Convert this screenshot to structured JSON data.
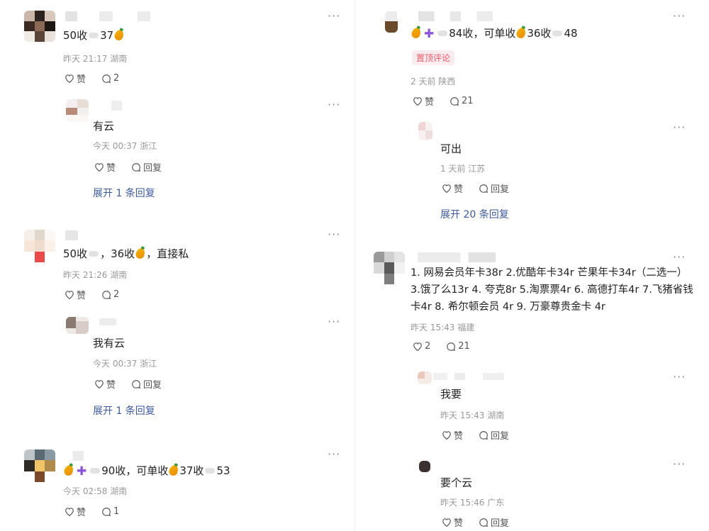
{
  "left": {
    "c1": {
      "stat_count": "50收",
      "stat_mango": "37",
      "meta": "昨天 21:17 湖南",
      "like": "赞",
      "reply_count": "2"
    },
    "r1": {
      "text": "有云",
      "meta": "今天 00:37 浙江",
      "like": "赞",
      "reply": "回复",
      "expand": "展开 1 条回复"
    },
    "c2": {
      "pre": "50收",
      "count": "，36收",
      "tail": "，直接私",
      "meta": "昨天 21:26 湖南",
      "like": "赞",
      "reply_count": "2"
    },
    "r2": {
      "text": "我有云",
      "meta": "今天 00:37 浙江",
      "like": "赞",
      "reply": "回复",
      "expand": "展开 1 条回复"
    },
    "c3": {
      "pre": "90收，可单收",
      "mid": "37收",
      "tail": "53",
      "meta": "今天 02:58 湖南",
      "like": "赞",
      "reply_count": "1"
    }
  },
  "right": {
    "c1": {
      "pre": "84收，可单收",
      "mid": "36收",
      "tail": "48",
      "pinned": "置顶评论",
      "meta": "2 天前 陕西",
      "like": "赞",
      "reply_count": "21"
    },
    "r1": {
      "text": "可出",
      "meta": "1 天前 江苏",
      "like": "赞",
      "reply": "回复",
      "expand": "展开 20 条回复"
    },
    "c2": {
      "text": "1. 网易会员年卡38r 2.优酷年卡34r 芒果年卡34r（二选一） 3.饿了么13r 4. 夸克8r 5.淘票票4r 6. 高德打车4r 7.飞猪省钱卡4r 8. 希尔顿会员 4r 9. 万豪尊贵金卡 4r",
      "meta": "昨天 15:43 福建",
      "like_count": "2",
      "reply_count": "21"
    },
    "r2": {
      "text": "我要",
      "meta": "昨天 15:43 湖南",
      "like": "赞",
      "reply": "回复"
    },
    "r3": {
      "text": "要个云",
      "meta": "昨天 15:46 广东",
      "like": "赞",
      "reply": "回复"
    }
  },
  "icons": [
    "heart-icon",
    "comment-bubble-icon",
    "more-dots-icon",
    "mango-emoji-icon",
    "cloud-emoji-icon",
    "plus-emoji-icon"
  ],
  "colors": {
    "link": "#3d5a99",
    "pinned": "#e85a6a",
    "meta": "#999999"
  }
}
